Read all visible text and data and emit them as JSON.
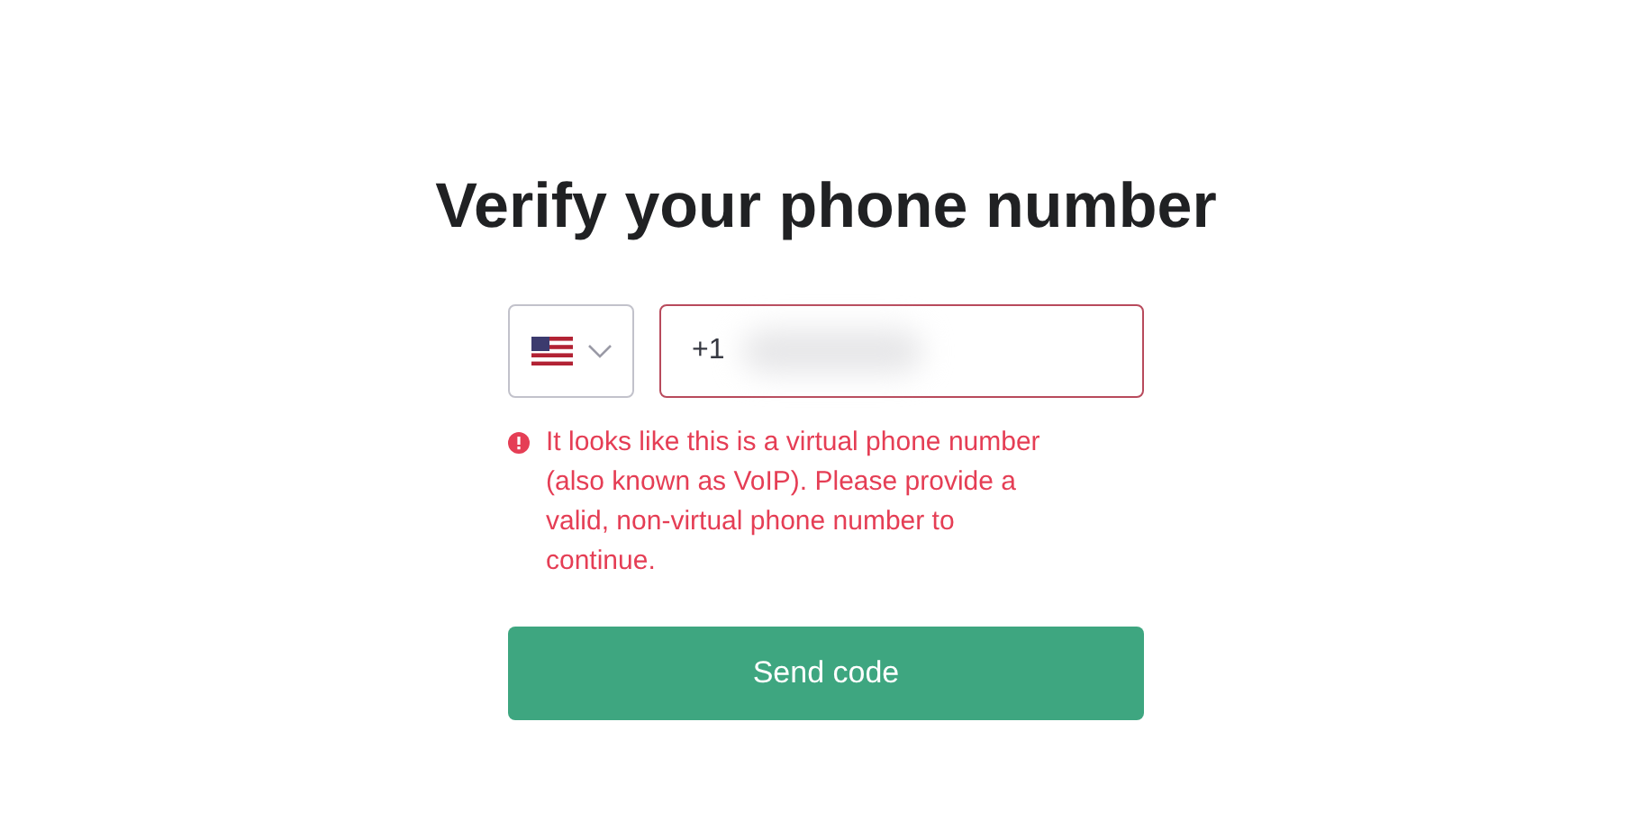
{
  "title": "Verify your phone number",
  "country_select": {
    "expanded": false
  },
  "phone_field": {
    "value": "+1",
    "invalid": true
  },
  "error_message": "It looks like this is a virtual phone number (also known as VoIP). Please provide a valid, non-virtual phone number to continue.",
  "submit_button": {
    "label": "Send code"
  }
}
